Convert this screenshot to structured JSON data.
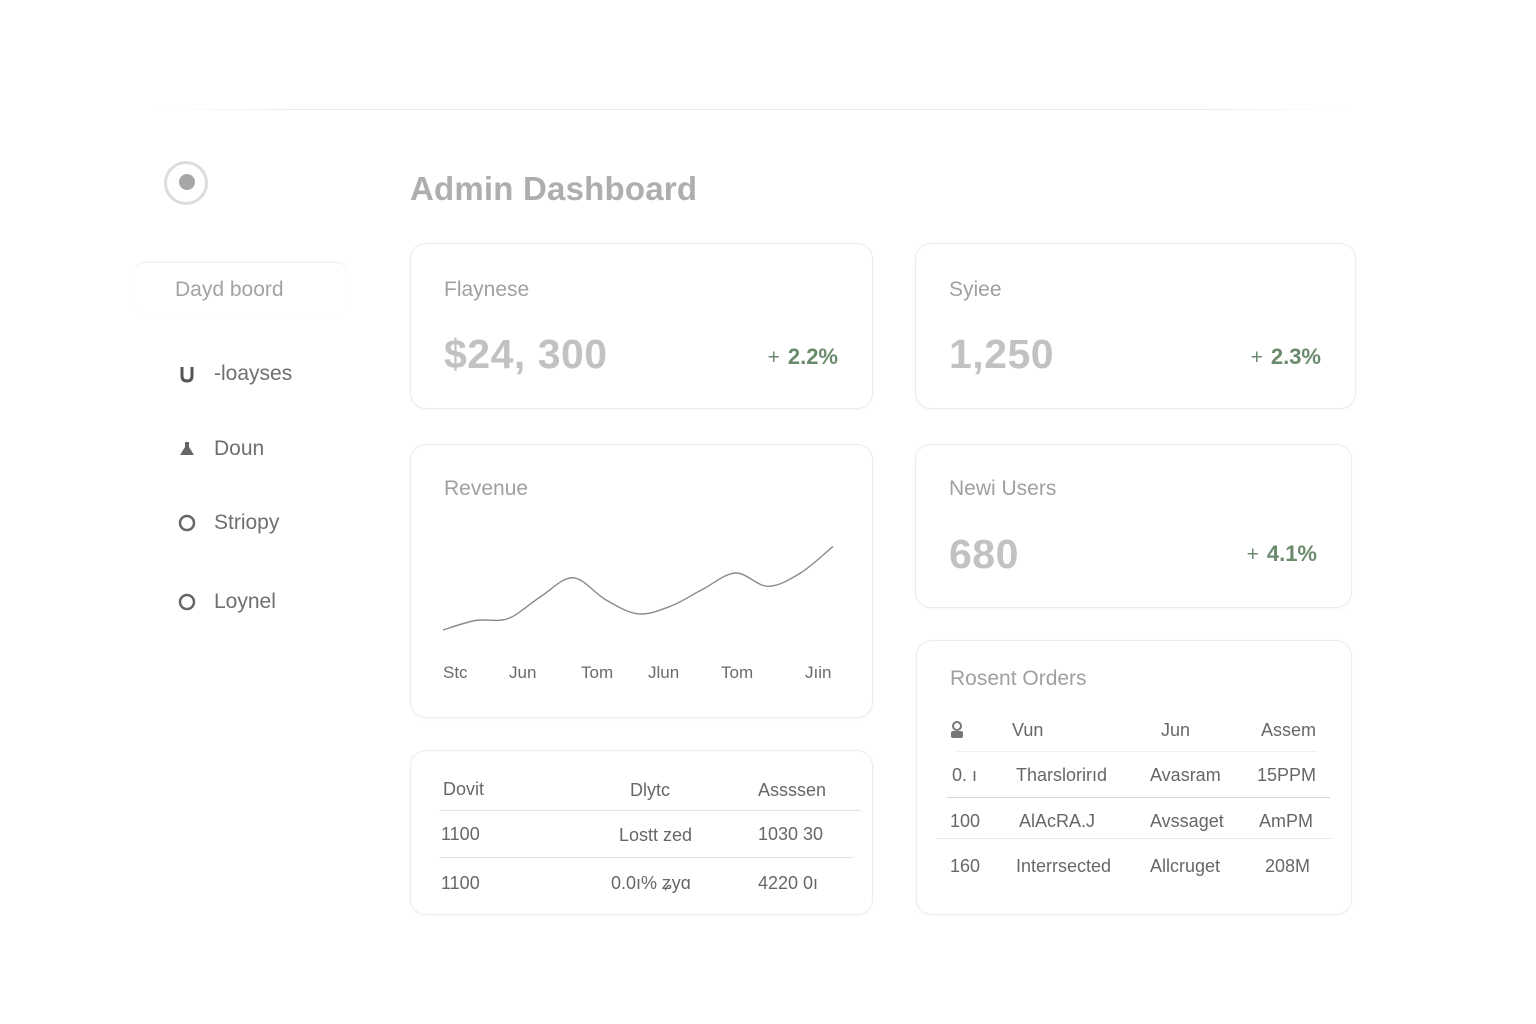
{
  "page": {
    "title": "Admin Dashboard"
  },
  "sidebar": {
    "active_item": "Dayd boord",
    "items": [
      {
        "label": "-loayses",
        "icon": "u-shape-icon"
      },
      {
        "label": "Doun",
        "icon": "flask-icon"
      },
      {
        "label": "Striopy",
        "icon": "circle-icon"
      },
      {
        "label": "Loynel",
        "icon": "circle-icon"
      }
    ]
  },
  "stats": {
    "card1": {
      "label": "Flaynese",
      "value": "$24, 300",
      "plus": "+",
      "delta": "2.2%"
    },
    "card2": {
      "label": "Syiee",
      "value": "1,250",
      "plus": "+",
      "delta": "2.3%"
    },
    "card3": {
      "label": "Newi Users",
      "value": "680",
      "plus": "+",
      "delta": "4.1%"
    }
  },
  "revenue": {
    "title": "Revenue",
    "x_ticks": [
      "Stc",
      "Jun",
      "Tom",
      "Jlun",
      "Tom",
      "Jıin"
    ]
  },
  "chart_data": {
    "type": "line",
    "title": "Revenue",
    "categories": [
      "Stc",
      "Jun",
      "Tom",
      "Jlun",
      "Tom",
      "Jıin"
    ],
    "series": [
      {
        "values": [
          0.0,
          0.1,
          0.12,
          0.35,
          0.55,
          0.32,
          0.17,
          0.25,
          0.43,
          0.6,
          0.46,
          0.6,
          0.88
        ]
      }
    ],
    "ylim": [
      0,
      1
    ],
    "grid": false,
    "legend": "none"
  },
  "left_table": {
    "headers": [
      "Dovit",
      "Dlytc",
      "Assssen"
    ],
    "rows": [
      [
        "1100",
        "Lostt zed",
        "1030 30"
      ],
      [
        "1100",
        "0.0ı% ʑyɑ",
        "4220 0ı"
      ]
    ]
  },
  "orders": {
    "title": "Rosent Orders",
    "headers": [
      "Vun",
      "Jun",
      "Assem"
    ],
    "rows": [
      [
        "0. ı",
        "Tharslorirıd",
        "Avasram",
        "15PPM"
      ],
      [
        "100",
        "AlAcRA.J",
        "Avssaget",
        "AmPM"
      ],
      [
        "160",
        "Interrsected",
        "Allcruget",
        "208M"
      ]
    ]
  },
  "colors": {
    "accent_green": "#6b8a6c",
    "muted_text": "#a0a0a0"
  }
}
